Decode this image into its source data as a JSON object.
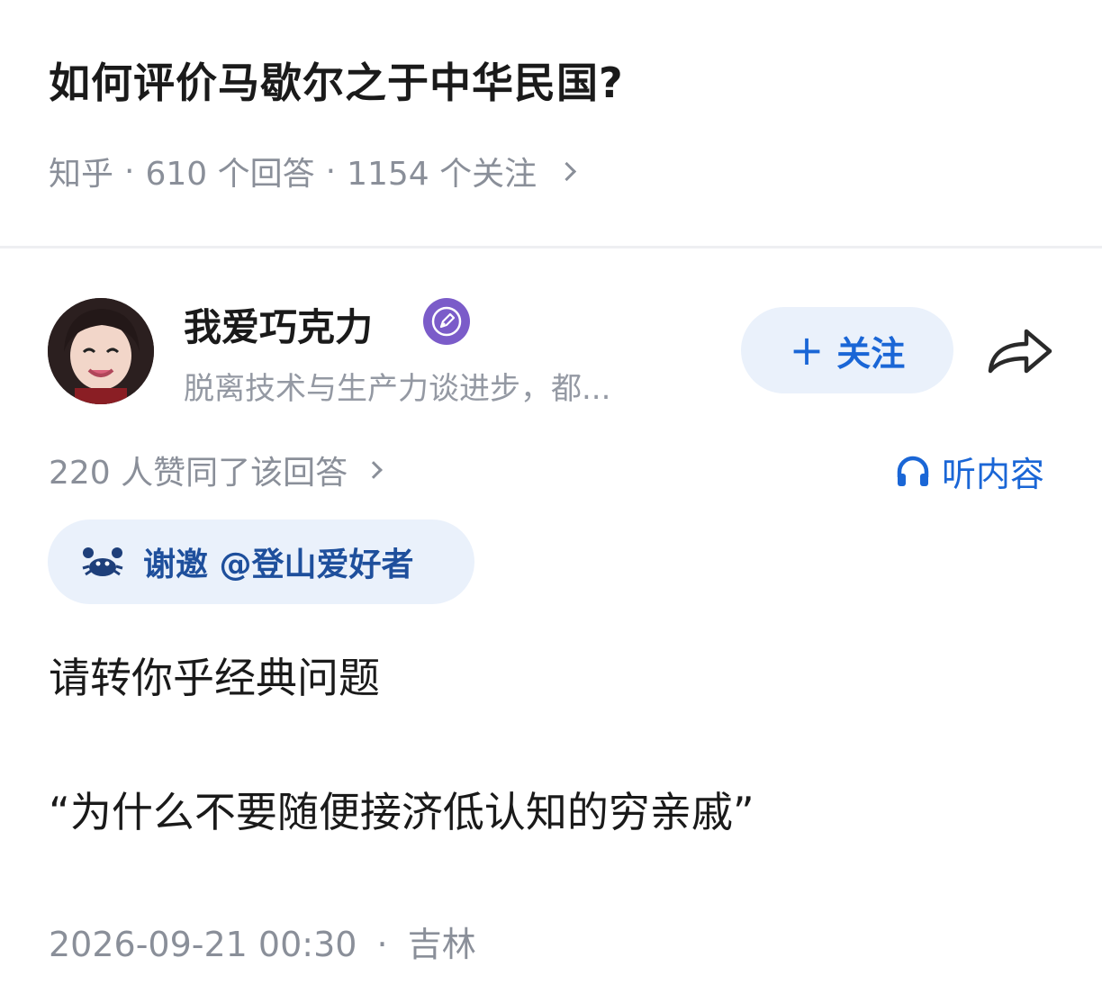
{
  "question": {
    "title": "如何评价马歇尔之于中华民国?",
    "source": "知乎",
    "answers": "610 个回答",
    "followers": "1154 个关注",
    "separator": "·"
  },
  "author": {
    "name": "我爱巧克力",
    "bio": "脱离技术与生产力谈进步，都...",
    "badge_icon": "pen-badge-icon",
    "avatar_icon": "avatar"
  },
  "actions": {
    "follow_plus": "+",
    "follow_label": "关注",
    "share_icon": "share-icon"
  },
  "answer_meta": {
    "likes": "220 人赞同了该回答",
    "listen_label": "听内容",
    "listen_icon": "headphones-icon"
  },
  "invite": {
    "label": "谢邀 @登山爱好者",
    "icon": "crab-icon"
  },
  "content": {
    "paragraph1": "请转你乎经典问题",
    "paragraph2": "“为什么不要随便接济低认知的穷亲戚”"
  },
  "footer": {
    "datetime": "2026-09-21 00:30",
    "separator": "·",
    "location": "吉林"
  },
  "colors": {
    "accent": "#1a66d6",
    "follow_bg": "#eaf1fb",
    "meta_gray": "#8a8f99",
    "badge_purple": "#7b5cc9"
  }
}
